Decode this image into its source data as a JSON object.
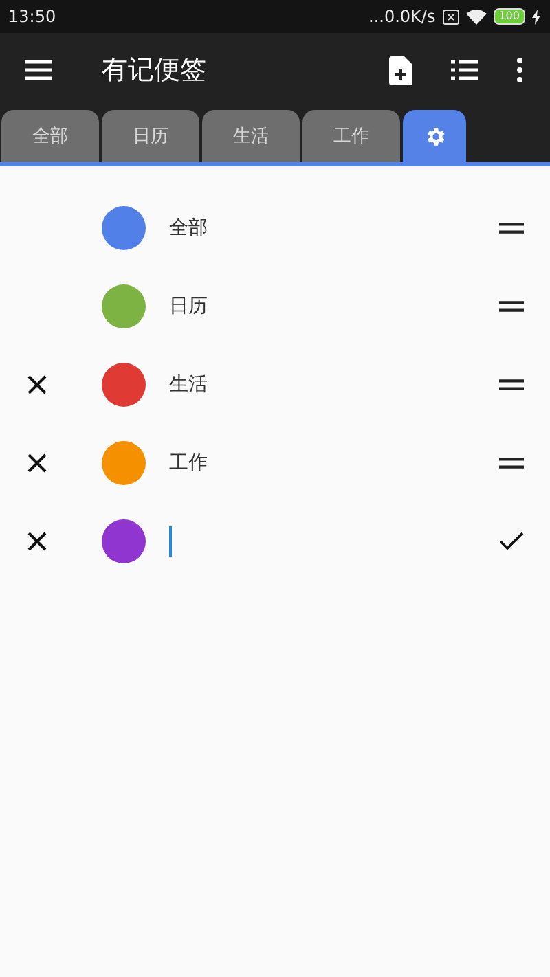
{
  "status_bar": {
    "time": "13:50",
    "speed": "...0.0K/s",
    "battery": "100"
  },
  "app_bar": {
    "title": "有记便签"
  },
  "tabs": [
    {
      "kind": "label",
      "label": "全部",
      "selected": false
    },
    {
      "kind": "label",
      "label": "日历",
      "selected": false
    },
    {
      "kind": "label",
      "label": "生活",
      "selected": false
    },
    {
      "kind": "label",
      "label": "工作",
      "selected": false
    },
    {
      "kind": "settings",
      "selected": true
    }
  ],
  "categories": [
    {
      "kind": "item",
      "name": "全部",
      "color": "#5080e8",
      "deletable": false
    },
    {
      "kind": "item",
      "name": "日历",
      "color": "#7cb342",
      "deletable": false
    },
    {
      "kind": "item",
      "name": "生活",
      "color": "#e03a35",
      "deletable": true
    },
    {
      "kind": "item",
      "name": "工作",
      "color": "#f59000",
      "deletable": true
    },
    {
      "kind": "new",
      "color": "#9035cf",
      "deletable": true
    }
  ]
}
